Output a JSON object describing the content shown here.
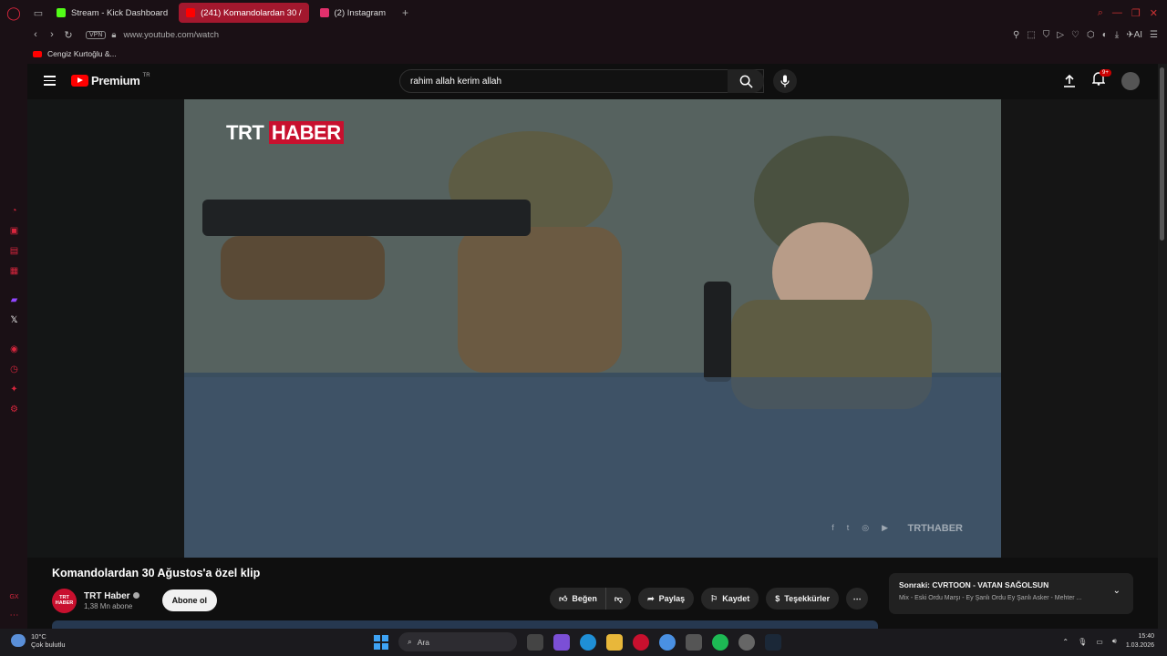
{
  "browser": {
    "tabs": [
      {
        "label": "Stream - Kick Dashboard",
        "color": "#53fc18"
      },
      {
        "label": "(241) Komandolardan 30 /",
        "color": "#ff0000",
        "active": true
      },
      {
        "label": "(2) Instagram",
        "color": "#e1306c"
      }
    ],
    "vpn_label": "VPN",
    "url": "www.youtube.com/watch",
    "ai_label": "AI",
    "bookmark": "Cengiz Kurtoğlu &..."
  },
  "youtube": {
    "logo_text": "Premium",
    "logo_region": "TR",
    "search_value": "rahim allah kerim allah",
    "notif_count": "9+",
    "video": {
      "channel_bug_left": "TRT",
      "channel_bug_right": "HABER",
      "watermark": "TRTHABER",
      "watermark_icons": [
        "f",
        "t",
        "◎",
        "▶"
      ]
    },
    "title": "Komandolardan 30 Ağustos'a özel klip",
    "channel": {
      "avatar_text": "TRT HABER",
      "name": "TRT Haber",
      "subs": "1,38 Mn abone",
      "subscribe": "Abone ol"
    },
    "actions": {
      "like": "Beğen",
      "share": "Paylaş",
      "save": "Kaydet",
      "thanks": "Teşekkürler"
    },
    "next": {
      "label": "Sonraki:",
      "title": "CVRTOON - VATAN SAĞOLSUN",
      "sub": "Mix - Eski Ordu Marşı - Ey Şanlı Ordu Ey Şanlı Asker - Mehter ..."
    }
  },
  "taskbar": {
    "temp": "10°C",
    "weather": "Çok bulutlu",
    "search": "Ara",
    "time": "15:40",
    "date": "1.03.2026"
  }
}
